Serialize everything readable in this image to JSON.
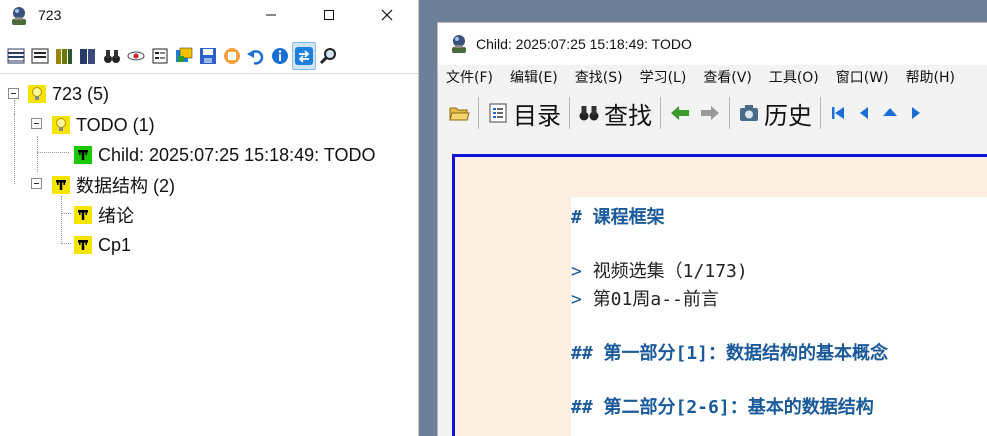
{
  "left_window": {
    "title": "723",
    "tree": [
      {
        "label": "723 (5)",
        "icon": "bulb-icon",
        "level": 0
      },
      {
        "label": "TODO (1)",
        "icon": "bulb-icon",
        "level": 1
      },
      {
        "label": "Child: 2025:07:25 15:18:49: TODO",
        "icon": "topic-green-icon",
        "level": 2
      },
      {
        "label": "数据结构 (2)",
        "icon": "topic-yellow-icon",
        "level": 1
      },
      {
        "label": "绪论",
        "icon": "topic-yellow-icon",
        "level": 2
      },
      {
        "label": "Cp1",
        "icon": "topic-yellow-icon",
        "level": 2
      }
    ]
  },
  "right_window": {
    "title": "Child: 2025:07:25 15:18:49: TODO",
    "menu": [
      "文件(F)",
      "编辑(E)",
      "查找(S)",
      "学习(L)",
      "查看(V)",
      "工具(O)",
      "窗口(W)",
      "帮助(H)"
    ],
    "toolbar": {
      "contents_label": "目录",
      "search_label": "查找",
      "history_label": "历史"
    },
    "content_lines": [
      {
        "type": "h1",
        "text": "# 课程框架"
      },
      {
        "type": "quote",
        "text": "视频选集（1/173)"
      },
      {
        "type": "quote",
        "text": "第01周a--前言"
      },
      {
        "type": "h2",
        "text": "## 第一部分[1]：数据结构的基本概念"
      },
      {
        "type": "h2",
        "text": "## 第二部分[2-6]：基本的数据结构"
      }
    ]
  },
  "colors": {
    "content_frame": "#1414d9",
    "heading": "#1a5a9a",
    "page_bg": "#fdf0e3",
    "bulb": "#f5e400",
    "topic_green": "#19c800"
  }
}
